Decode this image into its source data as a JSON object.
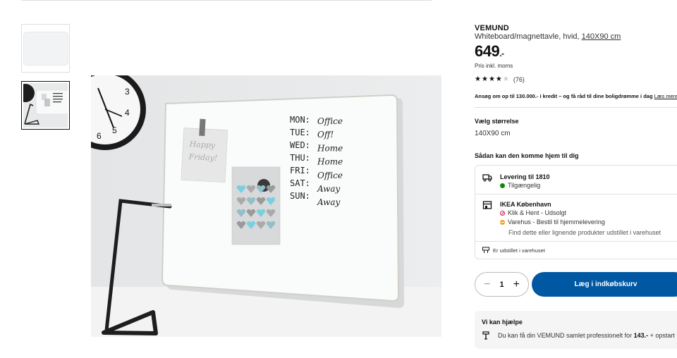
{
  "product": {
    "name": "VEMUND",
    "description": "Whiteboard/magnettavle, hvid,",
    "size_link": "140X90 cm",
    "price": "649",
    "price_suffix": ".-",
    "price_note": "Pris inkl. moms",
    "rating_stars": 4,
    "rating_max": 5,
    "review_count": "(76)"
  },
  "credit": {
    "text": "Ansøg om op til 130.000.- i kredit – og få råd til dine boligdrømme i dag",
    "link": "Læs mere"
  },
  "size": {
    "label": "Vælg størrelse",
    "value": "140X90 cm"
  },
  "delivery": {
    "heading": "Sådan kan den komme hjem til dig",
    "home": {
      "title": "Levering til 1810",
      "status": "Tilgængelig",
      "status_color": "#0a8a00",
      "icon": "truck-icon"
    },
    "store": {
      "title": "IKEA København",
      "click_collect": "Klik & Hent - Udsolgt",
      "warehouse": "Varehus - Bestil til hjemmelevering",
      "note": "Find dette eller lignende produkter udstillet i varehuset",
      "icon": "store-icon"
    },
    "showroom": "Er udstillet i varehuset"
  },
  "cart": {
    "quantity": "1",
    "minus": "−",
    "plus": "+",
    "add_label": "Læg i indkøbskurv",
    "accent": "#0058a3"
  },
  "help": {
    "title": "Vi kan hjælpe",
    "text_pre": "Du kan få din VEMUND samlet professionelt for",
    "price": "143.-",
    "text_post": "+ opstart"
  },
  "image": {
    "whiteboard_text": [
      "MON:",
      "TUE:",
      "WED:",
      "THU:",
      "FRI:",
      "SAT:",
      "SUN:"
    ],
    "whiteboard_values": [
      "Office",
      "Off!",
      "Home",
      "Home",
      "Office",
      "Away",
      "Away"
    ],
    "note_text": [
      "Happy",
      "Friday!"
    ],
    "clock_numbers": [
      "3",
      "4",
      "5",
      "6"
    ]
  }
}
